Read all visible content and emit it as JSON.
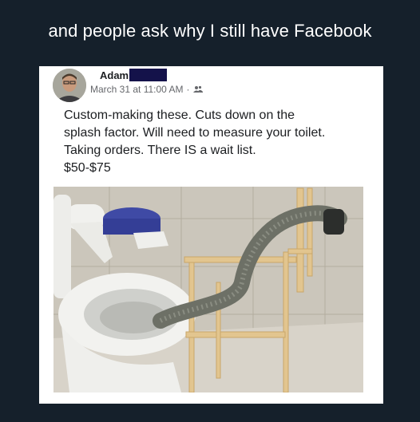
{
  "caption": "and people ask why I still have Facebook",
  "post": {
    "author": "Adam",
    "timestamp": "March 31 at 11:00 AM",
    "separator": "·",
    "audience_icon": "friends-icon",
    "text_lines": [
      "Custom-making these. Cuts down on the",
      "splash factor. Will need to measure your toilet.",
      "Taking orders. There IS a wait list.",
      "$50-$75"
    ]
  },
  "colors": {
    "page_background": "#15202b",
    "card_background": "#ffffff",
    "redaction": "#14124a",
    "meta_text": "#65676b"
  }
}
